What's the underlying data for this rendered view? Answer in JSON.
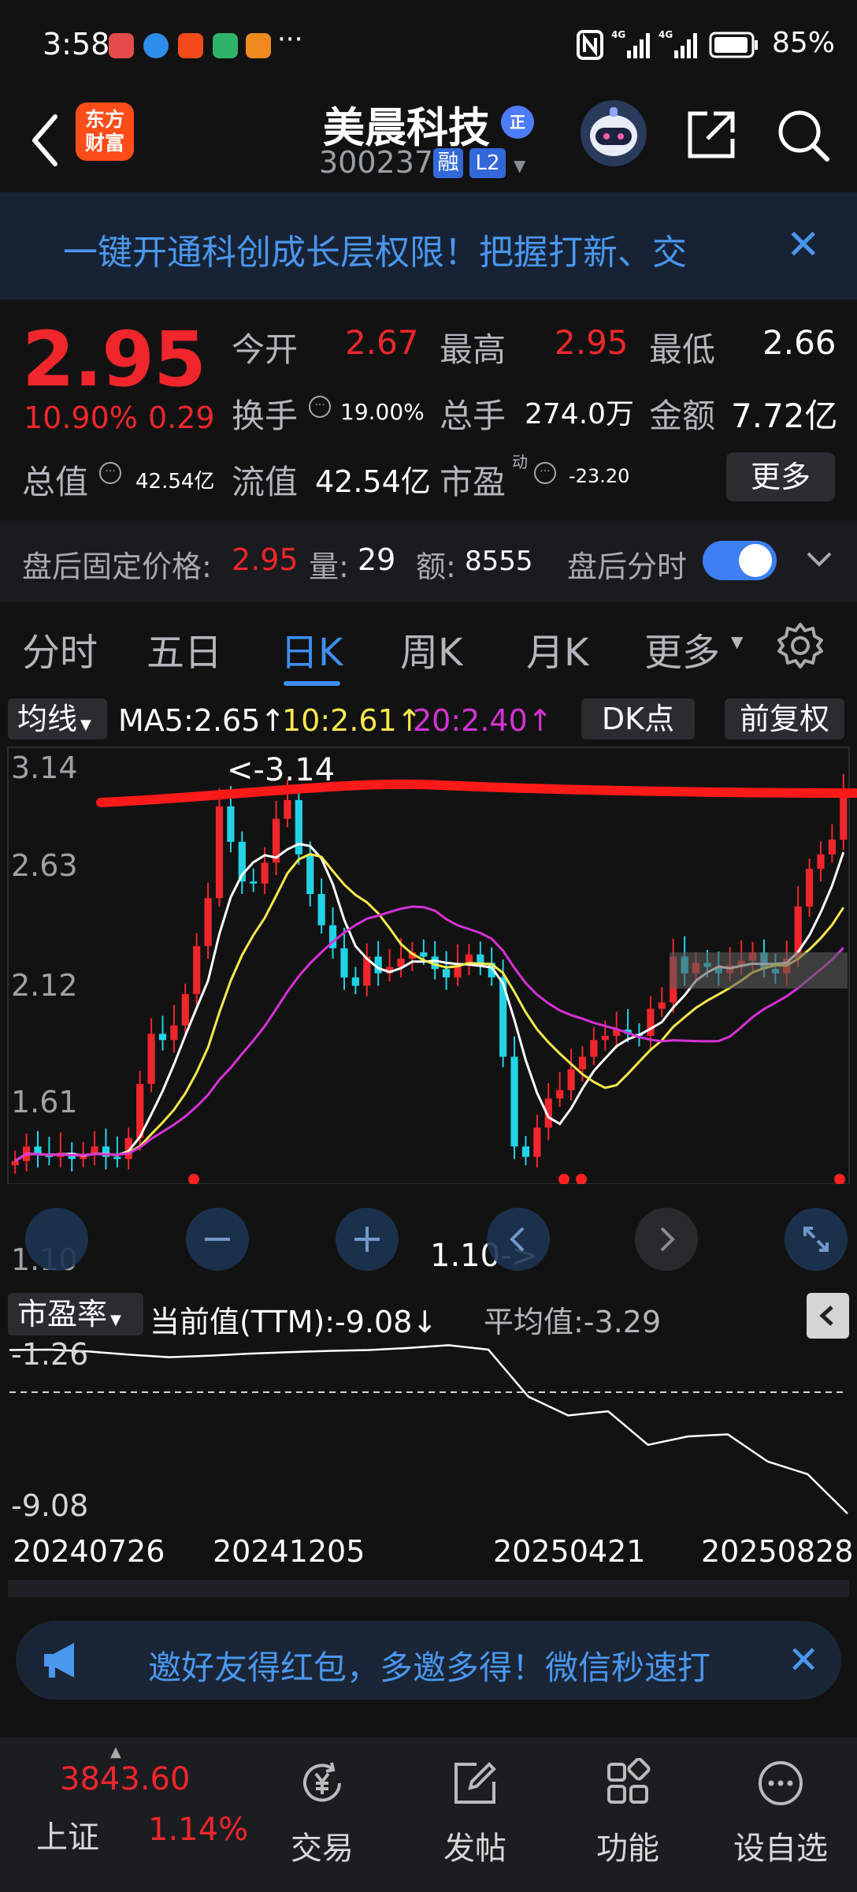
{
  "status_bar": {
    "time": "3:58",
    "more_dots": "···",
    "battery": "85%"
  },
  "header": {
    "logo_text": "东方财富",
    "stock_name": "美晨科技",
    "zheng_badge": "正",
    "stock_code": "300237",
    "rong_badge": "融",
    "l2_badge": "L2"
  },
  "notice": {
    "text": "一键开通科创成长层权限！把握打新、交",
    "close": "✕"
  },
  "quote": {
    "price": "2.95",
    "change_percent": "10.90%",
    "change_value": "0.29",
    "open_label": "今开",
    "open_value": "2.67",
    "high_label": "最高",
    "high_value": "2.95",
    "low_label": "最低",
    "low_value": "2.66",
    "turnover_label": "换手",
    "turnover_value": "19.00%",
    "volume_label": "总手",
    "volume_value": "274.0万",
    "amount_label": "金额",
    "amount_value": "7.72亿",
    "total_value_label": "总值",
    "total_value": "42.54亿",
    "float_value_label": "流值",
    "float_value": "42.54亿",
    "pe_label": "市盈",
    "pe_sup": "动",
    "pe_value": "-23.20",
    "more_button": "更多"
  },
  "after_hours": {
    "price_label": "盘后固定价格:",
    "price_value": "2.95",
    "volume_label": "量:",
    "volume_value": "29",
    "amount_label": "额:",
    "amount_value": "8555",
    "minute_label": "盘后分时",
    "toggle_on": true
  },
  "tabs": {
    "items": [
      {
        "label": "分时"
      },
      {
        "label": "五日"
      },
      {
        "label": "日K"
      },
      {
        "label": "周K"
      },
      {
        "label": "月K"
      },
      {
        "label": "更多"
      }
    ],
    "active_index": 2
  },
  "chart_controls": {
    "ma_select": "均线",
    "ma5": "MA5:2.65",
    "ma10": "10:2.61",
    "ma20": "20:2.40",
    "arrow_up": "↑",
    "dk_button": "DK点",
    "fq_button": "前复权"
  },
  "chart_data": [
    {
      "type": "candlestick",
      "title": "",
      "y_ticks": [
        "3.14",
        "2.63",
        "2.12",
        "1.61",
        "1.10"
      ],
      "ylim": [
        1.1,
        3.14
      ],
      "high_label": "<-3.14",
      "low_label": "1.10->",
      "close_series_sample": [
        1.18,
        1.25,
        1.21,
        1.2,
        1.22,
        1.19,
        1.21,
        1.25,
        1.2,
        1.19,
        1.29,
        1.55,
        1.79,
        1.76,
        1.83,
        1.98,
        2.21,
        2.44,
        2.88,
        2.71,
        2.52,
        2.51,
        2.61,
        2.82,
        2.91,
        2.65,
        2.46,
        2.31,
        2.2,
        2.06,
        2.02,
        2.16,
        2.08,
        2.11,
        2.15,
        2.18,
        2.16,
        2.1,
        2.06,
        2.12,
        2.17,
        2.13,
        2.06,
        1.68,
        1.25,
        1.2,
        1.34,
        1.48,
        1.52,
        1.62,
        1.68,
        1.76,
        1.78,
        1.81,
        1.79,
        1.78,
        1.91,
        1.94,
        2.16,
        2.08,
        2.13,
        2.11,
        2.08,
        2.12,
        2.14,
        2.18,
        2.1,
        2.08,
        2.15,
        2.4,
        2.58,
        2.65,
        2.72,
        2.95
      ],
      "colors": {
        "up": "#f0262c",
        "down": "#22d3e6",
        "ma5": "#ffffff",
        "ma10": "#f5e94d",
        "ma20": "#d532d5",
        "resistance_line": "#ff1a1a"
      }
    },
    {
      "type": "line",
      "title": "",
      "y_ticks": [
        "-1.26",
        "-9.08"
      ],
      "ylim": [
        -9.08,
        -1.26
      ],
      "x_ticks": [
        "20240726",
        "20241205",
        "20250421",
        "20250828"
      ],
      "values": [
        -1.28,
        -1.26,
        -1.35,
        -1.5,
        -1.62,
        -1.55,
        -1.45,
        -1.38,
        -1.32,
        -1.28,
        -1.18,
        -1.05,
        -1.26,
        -3.5,
        -4.4,
        -4.2,
        -5.8,
        -5.4,
        -5.3,
        -6.6,
        -7.2,
        -9.08
      ],
      "colors": {
        "line": "#ffffff",
        "average_line": "#d5d5d5"
      }
    }
  ],
  "pe_indicator": {
    "select": "市盈率",
    "current": "当前值(TTM):-9.08",
    "down_arrow": "↓",
    "average": "平均值:-3.29"
  },
  "promo": {
    "text": "邀好友得红包，多邀多得！微信秒速打",
    "close": "✕"
  },
  "bottom_nav": {
    "index_value": "3843.60",
    "index_name": "上证",
    "index_change": "1.14%",
    "items": [
      {
        "label": "交易"
      },
      {
        "label": "发帖"
      },
      {
        "label": "功能"
      },
      {
        "label": "设自选"
      }
    ]
  }
}
